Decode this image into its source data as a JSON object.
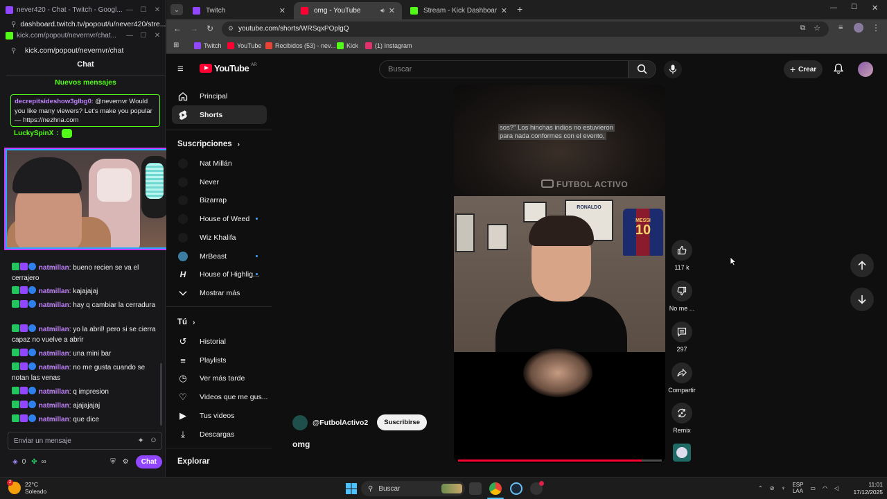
{
  "left_windows": {
    "twitch_window_title": "never420 - Chat - Twitch - Googl...",
    "twitch_url": "dashboard.twitch.tv/popout/u/never420/stre...",
    "kick_window_title": "kick.com/popout/nevernvr/chat...",
    "kick_url": "kick.com/popout/nevernvr/chat"
  },
  "chat": {
    "header": "Chat",
    "new_messages": "Nuevos mensajes",
    "spam_user": "decrepitsideshow3glbg0",
    "spam_text": ": @nevernvr Would you like many viewers? Let's make you popular — https://nezhna.com",
    "lucky_user": "LuckySpinX",
    "lucky_colon": ":",
    "messages": [
      {
        "user": "natmillan",
        "text": ": bueno recien se va el cerrajero"
      },
      {
        "user": "natmillan",
        "text": ": kajajajaj"
      },
      {
        "user": "natmillan",
        "text": ": hay q cambiar la cerradura"
      },
      {
        "user": "natmillan",
        "text": ": yo la abril! pero si se cierra capaz no vuelve a abrir"
      },
      {
        "user": "natmillan",
        "text": ": una mini bar"
      },
      {
        "user": "natmillan",
        "text": ": no me gusta cuando se notan las venas"
      },
      {
        "user": "natmillan",
        "text": ": q impresion"
      },
      {
        "user": "natmillan",
        "text": ": ajajajajaj"
      },
      {
        "user": "natmillan",
        "text": ": que dice"
      }
    ],
    "input_placeholder": "Enviar un mensaje",
    "points": "0",
    "infinity": "∞",
    "chat_button": "Chat"
  },
  "browser": {
    "tabs": [
      {
        "label": "Twitch",
        "color": "#9147ff"
      },
      {
        "label": "omg - YouTube",
        "color": "#ff0033"
      },
      {
        "label": "Stream - Kick Dashboard",
        "color": "#53fc18"
      }
    ],
    "url": "youtube.com/shorts/WRSqxPOplgQ",
    "bookmarks": [
      {
        "label": "Twitch",
        "color": "#9147ff"
      },
      {
        "label": "YouTube",
        "color": "#ff0033"
      },
      {
        "label": "Recibidos (53) - nev...",
        "color": "#ea4335"
      },
      {
        "label": "Kick",
        "color": "#53fc18"
      },
      {
        "label": "(1) Instagram",
        "color": "#e1306c"
      }
    ]
  },
  "youtube": {
    "logo": "YouTube",
    "region": "AR",
    "search_placeholder": "Buscar",
    "create_label": "Crear",
    "nav": {
      "home": "Principal",
      "shorts": "Shorts",
      "subscriptions_heading": "Suscripciones",
      "subscriptions": [
        {
          "name": "Nat Millán",
          "dot": false
        },
        {
          "name": "Never",
          "dot": false
        },
        {
          "name": "Bizarrap",
          "dot": false
        },
        {
          "name": "House of Weed",
          "dot": true
        },
        {
          "name": "Wiz Khalifa",
          "dot": false
        },
        {
          "name": "MrBeast",
          "dot": true
        },
        {
          "name": "House of Highlig...",
          "dot": true
        }
      ],
      "show_more": "Mostrar más",
      "you_heading": "Tú",
      "you_items": [
        "Historial",
        "Playlists",
        "Ver más tarde",
        "Videos que me gus...",
        "Tus videos",
        "Descargas"
      ],
      "explore_heading": "Explorar"
    },
    "short": {
      "caption_line1": "sos?\" Los hinchas indios no estuvieron",
      "caption_line2": "para nada conformes con el evento,",
      "watermark": "FUTBOL ACTIVO",
      "jersey_name": "MESSI",
      "jersey_number": "10",
      "frame_name": "RONALDO",
      "progress": 0.9,
      "channel": "@FutbolActivo2",
      "subscribe": "Suscribirse",
      "title": "omg"
    },
    "actions": {
      "likes": "117 k",
      "dislike": "No me ...",
      "comments": "297",
      "share": "Compartir",
      "remix": "Remix"
    }
  },
  "taskbar": {
    "temperature": "22°C",
    "weather": "Soleado",
    "notification_count": "2",
    "search": "Buscar",
    "lang_top": "ESP",
    "lang_bottom": "LAA",
    "time": "11:01",
    "date": "17/12/2025"
  }
}
